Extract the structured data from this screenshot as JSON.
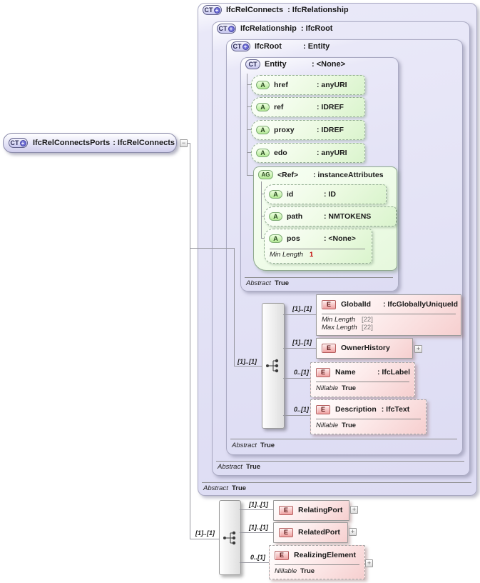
{
  "icons": {
    "ct": "CT",
    "plus": "+",
    "minus": "−",
    "a": "A",
    "ag": "AG",
    "e": "E"
  },
  "root": {
    "name": "IfcRelConnectsPorts",
    "type": ": IfcRelConnects"
  },
  "containers": {
    "relconnects": {
      "name": "IfcRelConnects",
      "type": ": IfcRelationship",
      "facet_label": "Abstract",
      "facet_value": "True"
    },
    "relationship": {
      "name": "IfcRelationship",
      "type": ": IfcRoot",
      "facet_label": "Abstract",
      "facet_value": "True"
    },
    "ifcroot": {
      "name": "IfcRoot",
      "type": ": Entity",
      "facet_label": "Abstract",
      "facet_value": "True"
    },
    "entity": {
      "name": "Entity",
      "type": ": <None>",
      "facet_label": "Abstract",
      "facet_value": "True"
    }
  },
  "entity_attributes": [
    {
      "name": "href",
      "type": ": anyURI"
    },
    {
      "name": "ref",
      "type": ": IDREF"
    },
    {
      "name": "proxy",
      "type": ": IDREF"
    },
    {
      "name": "edo",
      "type": ": anyURI"
    }
  ],
  "attribute_group": {
    "name": "<Ref>",
    "type": ": instanceAttributes",
    "attributes": [
      {
        "name": "id",
        "type": ": ID"
      },
      {
        "name": "path",
        "type": ": NMTOKENS"
      },
      {
        "name": "pos",
        "type": ": <None>",
        "facet_label": "Min Length",
        "facet_value": "1"
      }
    ]
  },
  "root_sequence": {
    "cardinality": "[1]..[1]",
    "children": [
      {
        "cardinality": "[1]..[1]",
        "name": "GlobalId",
        "type": ": IfcGloballyUniqueId",
        "facets": [
          {
            "label": "Min Length",
            "value": "[22]"
          },
          {
            "label": "Max Length",
            "value": "[22]"
          }
        ]
      },
      {
        "cardinality": "[1]..[1]",
        "name": "OwnerHistory",
        "type": ""
      },
      {
        "cardinality": "0..[1]",
        "name": "Name",
        "type": ": IfcLabel",
        "facets": [
          {
            "label": "Nillable",
            "value": "True"
          }
        ]
      },
      {
        "cardinality": "0..[1]",
        "name": "Description",
        "type": ": IfcText",
        "facets": [
          {
            "label": "Nillable",
            "value": "True"
          }
        ]
      }
    ]
  },
  "ports_sequence": {
    "cardinality": "[1]..[1]",
    "children": [
      {
        "cardinality": "[1]..[1]",
        "name": "RelatingPort"
      },
      {
        "cardinality": "[1]..[1]",
        "name": "RelatedPort"
      },
      {
        "cardinality": "0..[1]",
        "name": "RealizingElement",
        "facets": [
          {
            "label": "Nillable",
            "value": "True"
          }
        ]
      }
    ]
  }
}
